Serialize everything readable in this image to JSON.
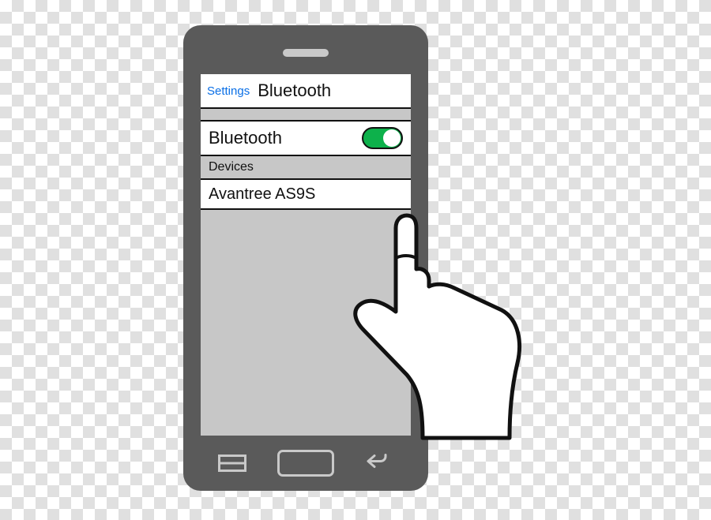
{
  "header": {
    "back_label": "Settings",
    "title": "Bluetooth"
  },
  "toggle": {
    "label": "Bluetooth",
    "state": "on"
  },
  "sections": {
    "devices_label": "Devices"
  },
  "devices": [
    {
      "name": "Avantree AS9S"
    }
  ]
}
